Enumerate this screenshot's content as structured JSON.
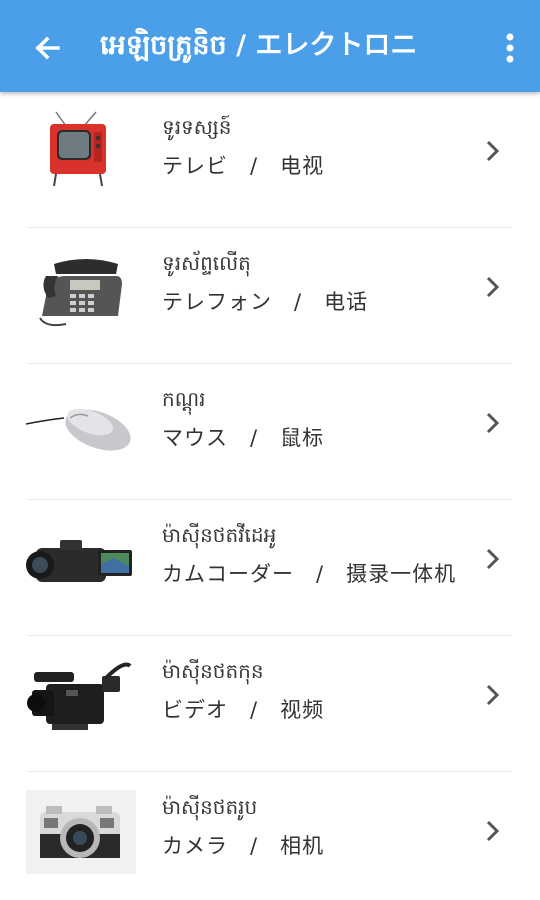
{
  "appbar": {
    "title": "អេឡិចត្រូនិច / エレクトロニ",
    "back_icon": "arrow-left-icon",
    "more_icon": "more-vert-icon",
    "color": "#4a9fe8"
  },
  "items": [
    {
      "khmer": "ទូរទស្សន៍",
      "text": "テレビ　/　电视",
      "image": "tv-image"
    },
    {
      "khmer": "ទូរស័ព្ទលើតុ",
      "text": "テレフォン　/　电话",
      "image": "desk-phone-image"
    },
    {
      "khmer": "កណ្ដុរ",
      "text": "マウス　/　鼠标",
      "image": "mouse-image"
    },
    {
      "khmer": "ម៉ាស៊ីនថតវីដេអូ",
      "text": "カムコーダー　/　摄录一体机",
      "image": "camcorder-image"
    },
    {
      "khmer": "ម៉ាស៊ីនថតកុន",
      "text": "ビデオ　/　视频",
      "image": "video-camera-image"
    },
    {
      "khmer": "ម៉ាស៊ីនថតរូប",
      "text": "カメラ　/　相机",
      "image": "camera-image"
    }
  ]
}
